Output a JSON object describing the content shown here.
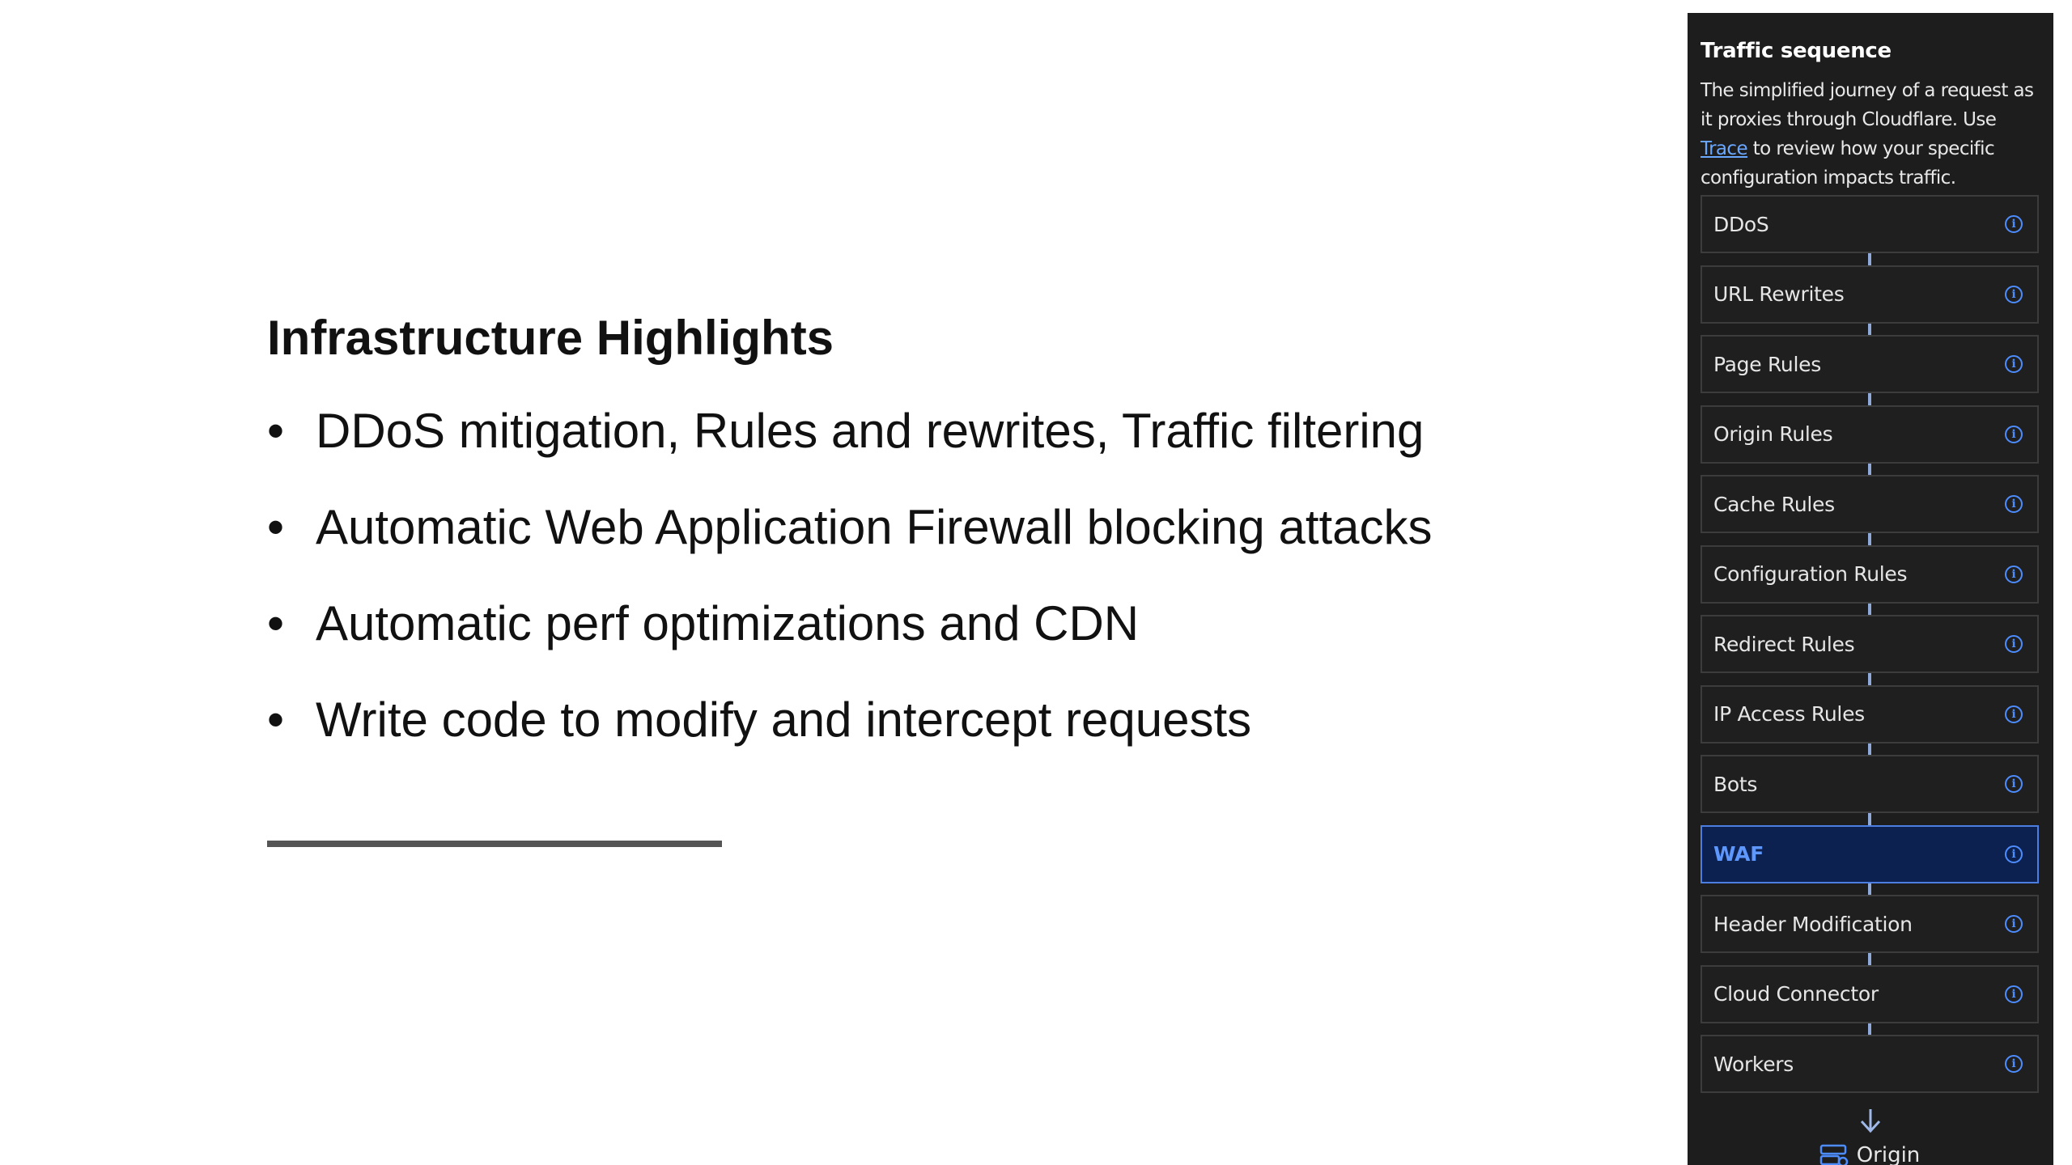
{
  "slide": {
    "title": "Infrastructure Highlights",
    "bullets": [
      "DDoS mitigation, Rules and rewrites, Traffic filtering",
      "Automatic Web Application Firewall blocking attacks",
      "Automatic perf optimizations and CDN",
      "Write code to modify and intercept requests"
    ],
    "bullet_glyph": "•"
  },
  "panel": {
    "title": "Traffic sequence",
    "description_before_link": "The simplified journey of a request as it proxies through Cloudflare. Use ",
    "link_text": "Trace",
    "description_after_link": " to review how your specific configuration impacts traffic.",
    "steps": [
      {
        "label": "DDoS",
        "active": false
      },
      {
        "label": "URL Rewrites",
        "active": false
      },
      {
        "label": "Page Rules",
        "active": false
      },
      {
        "label": "Origin Rules",
        "active": false
      },
      {
        "label": "Cache Rules",
        "active": false
      },
      {
        "label": "Configuration Rules",
        "active": false
      },
      {
        "label": "Redirect Rules",
        "active": false
      },
      {
        "label": "IP Access Rules",
        "active": false
      },
      {
        "label": "Bots",
        "active": false
      },
      {
        "label": "WAF",
        "active": true
      },
      {
        "label": "Header Modification",
        "active": false
      },
      {
        "label": "Cloud Connector",
        "active": false
      },
      {
        "label": "Workers",
        "active": false
      }
    ],
    "info_icon_glyph": "i",
    "destination_label": "Origin",
    "colors": {
      "panel_bg": "#1d1d1d",
      "accent": "#4d8dff",
      "active_bg": "#0d2150"
    },
    "icons": {
      "info": "info-circle-icon",
      "arrow": "arrow-down-icon",
      "origin": "server-icon"
    }
  }
}
